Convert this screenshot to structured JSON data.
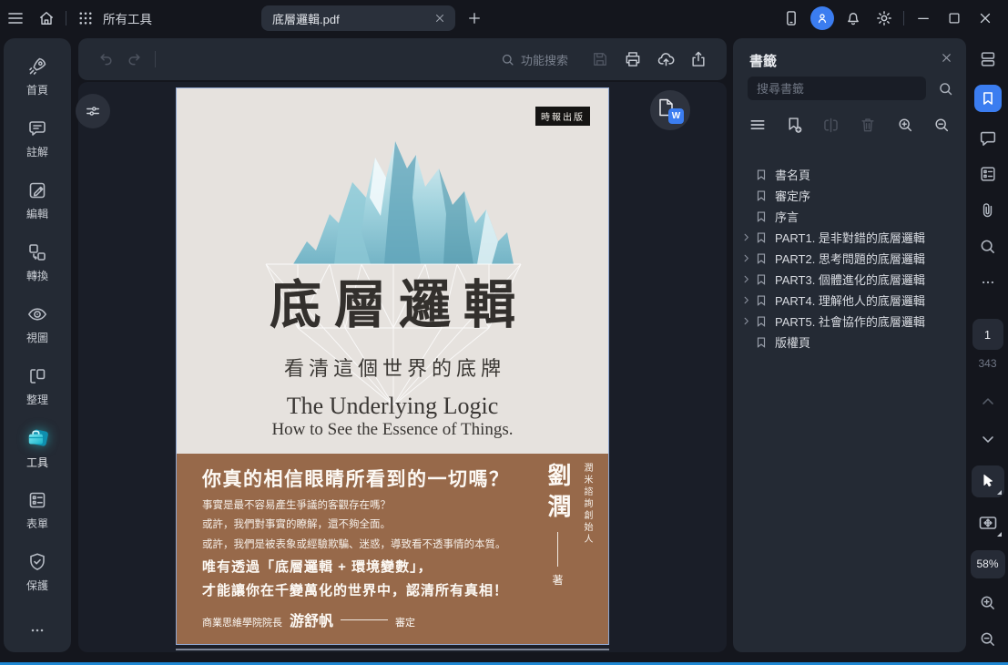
{
  "topbar": {
    "all_tools": "所有工具",
    "tab_title": "底層邏輯.pdf"
  },
  "toolbar": {
    "search_label": "功能搜索"
  },
  "sidebar": {
    "items": [
      {
        "label": "首頁"
      },
      {
        "label": "註解"
      },
      {
        "label": "編輯"
      },
      {
        "label": "轉換"
      },
      {
        "label": "視圖"
      },
      {
        "label": "整理"
      },
      {
        "label": "工具",
        "active": true
      },
      {
        "label": "表單"
      },
      {
        "label": "保護"
      }
    ]
  },
  "bookmarks": {
    "title": "書籤",
    "search_placeholder": "搜尋書籤",
    "items": [
      {
        "label": "書名頁",
        "expandable": false
      },
      {
        "label": "審定序",
        "expandable": false
      },
      {
        "label": "序言",
        "expandable": false
      },
      {
        "label": "PART1. 是非對錯的底層邏輯",
        "expandable": true
      },
      {
        "label": "PART2. 思考問題的底層邏輯",
        "expandable": true
      },
      {
        "label": "PART3. 個體進化的底層邏輯",
        "expandable": true
      },
      {
        "label": "PART4. 理解他人的底層邏輯",
        "expandable": true
      },
      {
        "label": "PART5. 社會協作的底層邏輯",
        "expandable": true
      },
      {
        "label": "版權頁",
        "expandable": false
      }
    ]
  },
  "pager": {
    "current_page": "1",
    "total_pages": "343",
    "zoom_level": "58%"
  },
  "cover": {
    "publisher": "時報出版",
    "title": "底層邏輯",
    "subtitle": "看清這個世界的底牌",
    "title_en": "The Underlying Logic",
    "subtitle_en": "How to See the Essence of Things.",
    "headline": "你真的相信眼睛所看到的一切嗎？",
    "line1": "事實是最不容易產生爭議的客觀存在嗎？",
    "line2": "或許，我們對事實的瞭解，還不夠全面。",
    "line3": "或許，我們是被表象或經驗欺騙、迷惑，導致看不透事情的本質。",
    "emphasis1": "唯有透過「底層邏輯 + 環境變數」，",
    "emphasis2": "才能讓你在千變萬化的世界中，認清所有真相！",
    "reviewer_role": "商業思維學院院長",
    "reviewer_name": "游舒帆",
    "reviewer_tag": "審定",
    "author": "劉潤",
    "author_role": "潤米諮詢創始人",
    "author_tag": "著"
  },
  "icons": {
    "word_badge": "W"
  },
  "colors": {
    "accent": "#3b7df0",
    "panel": "#242a34",
    "cover_background": "#e6e2de",
    "cover_brown": "#97694a"
  }
}
